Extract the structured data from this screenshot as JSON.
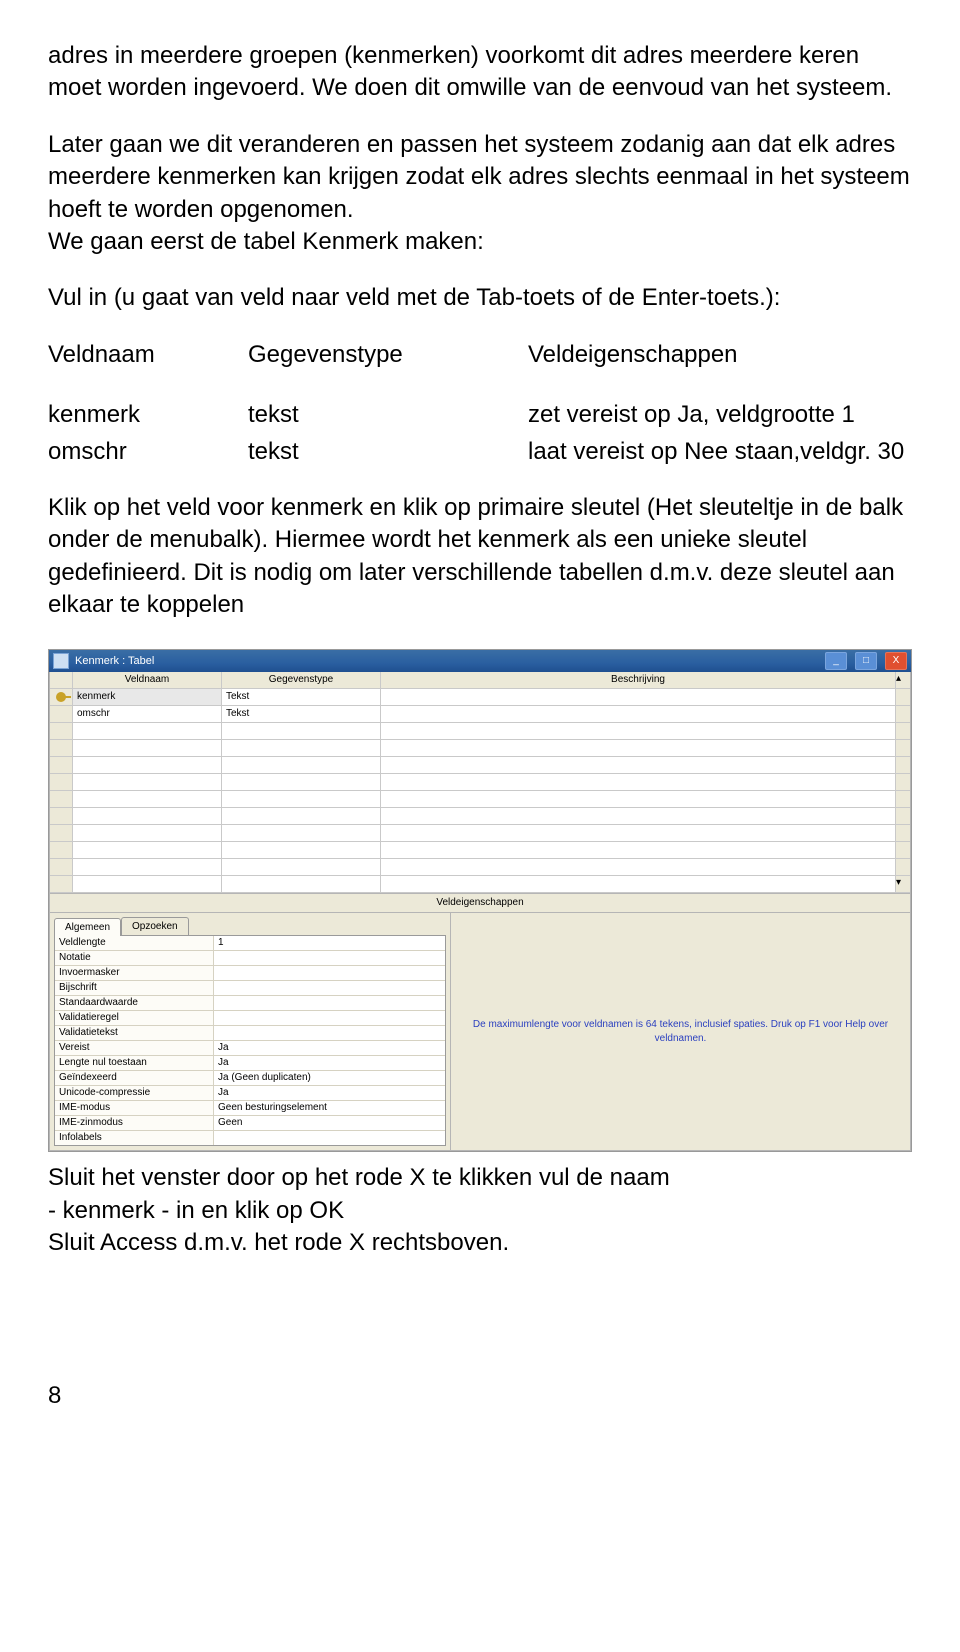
{
  "para1": "adres in meerdere groepen (kenmerken) voorkomt dit adres meerdere keren moet worden ingevoerd. We doen dit omwille van de eenvoud van het systeem.",
  "para2": "Later gaan we dit veranderen en passen het systeem zodanig aan dat elk adres meerdere kenmerken kan krijgen zodat elk adres slechts eenmaal in het systeem hoeft te worden opgenomen.",
  "para3": "We gaan eerst de tabel Kenmerk maken:",
  "para4": "Vul in (u gaat van veld naar veld met de Tab-toets of de Enter-toets.):",
  "hdr": {
    "c1": "Veldnaam",
    "c2": "Gegevenstype",
    "c3": "Veldeigenschappen"
  },
  "rows": [
    {
      "c1": "kenmerk",
      "c2": "tekst",
      "c3": "zet vereist op Ja, veldgrootte 1"
    },
    {
      "c1": "omschr",
      "c2": "tekst",
      "c3": "laat vereist op Nee staan,veldgr. 30"
    }
  ],
  "para5": "Klik op het veld voor kenmerk en klik op primaire sleutel (Het sleuteltje in de balk onder de menubalk). Hiermee wordt het kenmerk als een unieke sleutel gedefinieerd. Dit is nodig om later verschillende tabellen d.m.v. deze sleutel aan elkaar te koppelen",
  "screenshot": {
    "title": "Kenmerk : Tabel",
    "head": {
      "fn": "Veldnaam",
      "dt": "Gegevenstype",
      "desc": "Beschrijving"
    },
    "datarows": [
      {
        "fn": "kenmerk",
        "dt": "Tekst"
      },
      {
        "fn": "omschr",
        "dt": "Tekst"
      }
    ],
    "midbar": "Veldeigenschappen",
    "tabs": {
      "t1": "Algemeen",
      "t2": "Opzoeken"
    },
    "props": [
      {
        "l": "Veldlengte",
        "v": "1"
      },
      {
        "l": "Notatie",
        "v": ""
      },
      {
        "l": "Invoermasker",
        "v": ""
      },
      {
        "l": "Bijschrift",
        "v": ""
      },
      {
        "l": "Standaardwaarde",
        "v": ""
      },
      {
        "l": "Validatieregel",
        "v": ""
      },
      {
        "l": "Validatietekst",
        "v": ""
      },
      {
        "l": "Vereist",
        "v": "Ja"
      },
      {
        "l": "Lengte nul toestaan",
        "v": "Ja"
      },
      {
        "l": "Geïndexeerd",
        "v": "Ja (Geen duplicaten)"
      },
      {
        "l": "Unicode-compressie",
        "v": "Ja"
      },
      {
        "l": "IME-modus",
        "v": "Geen besturingselement"
      },
      {
        "l": "IME-zinmodus",
        "v": "Geen"
      },
      {
        "l": "Infolabels",
        "v": ""
      }
    ],
    "hint": "De maximumlengte voor veldnamen is 64 tekens, inclusief spaties. Druk op F1 voor Help over veldnamen."
  },
  "para6a": "Sluit het venster door op het rode X te klikken vul de naam",
  "para6b": "- kenmerk - in en klik op OK",
  "para6c": "Sluit Access d.m.v. het rode X rechtsboven.",
  "pagenum": "8"
}
